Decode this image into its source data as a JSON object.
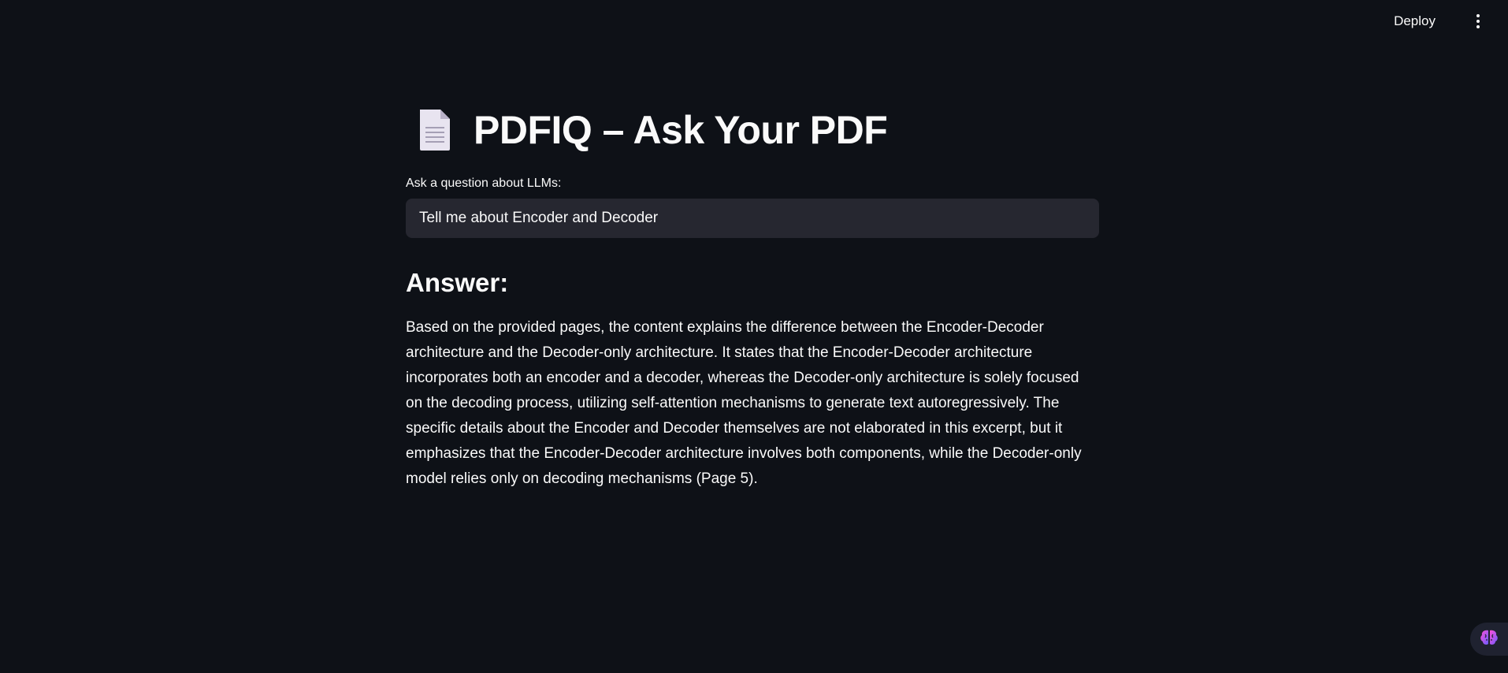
{
  "header": {
    "deploy_label": "Deploy",
    "menu_icon": "more-vertical-icon"
  },
  "main": {
    "title_icon": "page-document-icon",
    "title": "PDFIQ – Ask Your PDF",
    "question_label": "Ask a question about LLMs:",
    "question_value": "Tell me about Encoder and Decoder",
    "answer_heading": "Answer:",
    "answer_text": "Based on the provided pages, the content explains the difference between the Encoder-Decoder architecture and the Decoder-only architecture. It states that the Encoder-Decoder architecture incorporates both an encoder and a decoder, whereas the Decoder-only architecture is solely focused on the decoding process, utilizing self-attention mechanisms to generate text autoregressively. The specific details about the Encoder and Decoder themselves are not elaborated in this excerpt, but it emphasizes that the Encoder-Decoder architecture involves both components, while the Decoder-only model relies only on decoding mechanisms (Page 5)."
  },
  "assistant": {
    "icon": "brain-icon"
  },
  "colors": {
    "background": "#0e1117",
    "text": "#fafafa",
    "input_bg": "#262730"
  }
}
